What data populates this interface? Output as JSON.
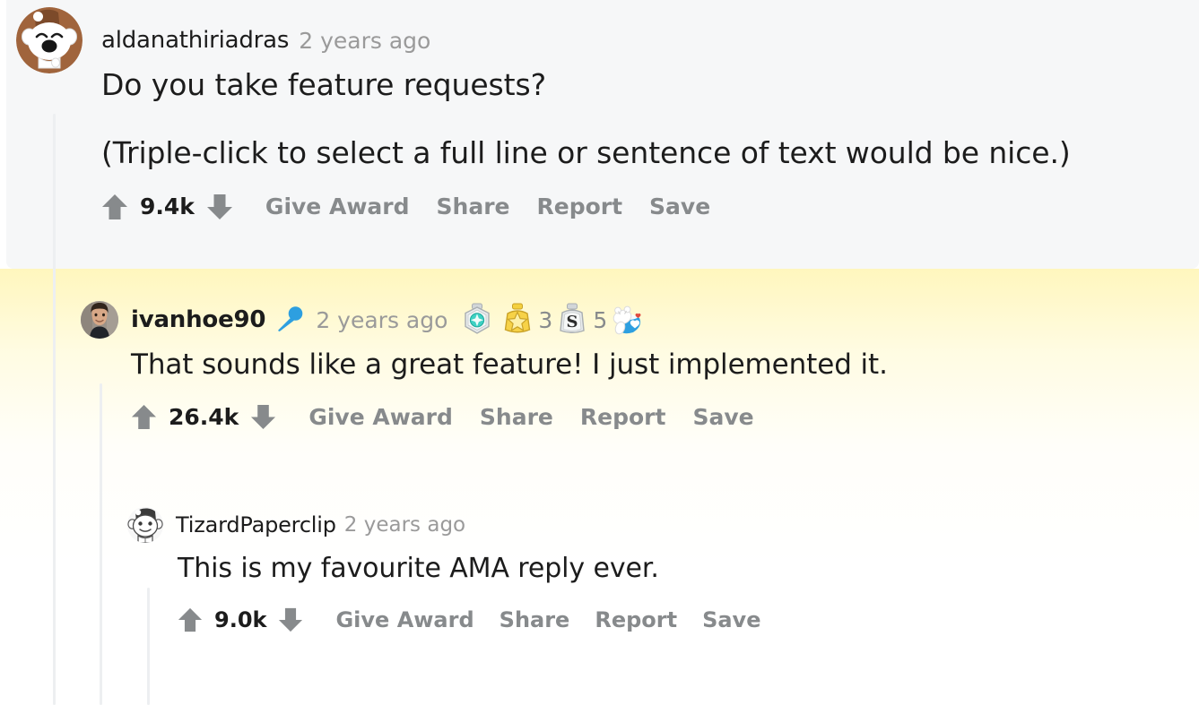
{
  "theme": {
    "highlight_bg": "#f6f7f8",
    "page_bg": "#ffffff",
    "thread_line": "#edeff1",
    "text_primary": "#1c1c1c",
    "text_muted": "#878a8c",
    "timestamp_color": "#9a9a9a",
    "gold_glow": "#fff6ba",
    "mic_badge_color": "#2d9fe0"
  },
  "comments": [
    {
      "id": "comment-1",
      "username": "aldanathiriadras",
      "timestamp": "2 years ago",
      "avatar": "snoo-brown-hair-avatar",
      "body": [
        "Do you take feature requests?",
        "(Triple-click to select a full line or sentence of text would be nice.)"
      ],
      "score": "9.4k",
      "upvote_icon": "upvote-arrow-icon",
      "downvote_icon": "downvote-arrow-icon",
      "actions": [
        "Give Award",
        "Share",
        "Report",
        "Save"
      ],
      "awards": [],
      "highlighted": true
    },
    {
      "id": "comment-2",
      "username": "ivanhoe90",
      "timestamp": "2 years ago",
      "avatar": "photo-portrait-avatar",
      "badge_icon": "microphone-badge-icon",
      "body": [
        "That sounds like a great feature! I just implemented it."
      ],
      "score": "26.4k",
      "upvote_icon": "upvote-arrow-icon",
      "downvote_icon": "downvote-arrow-icon",
      "actions": [
        "Give Award",
        "Share",
        "Report",
        "Save"
      ],
      "awards": [
        {
          "name": "platinum-award",
          "label": "Platinum",
          "count": ""
        },
        {
          "name": "gold-award",
          "label": "Gold",
          "count": "3"
        },
        {
          "name": "silver-award",
          "label": "Silver",
          "count": "5"
        },
        {
          "name": "wholesome-award",
          "label": "Wholesome",
          "count": ""
        }
      ],
      "highlighted": false
    },
    {
      "id": "comment-3",
      "username": "TizardPaperclip",
      "timestamp": "2 years ago",
      "avatar": "snoo-grey-hair-avatar",
      "body": [
        "This is my favourite AMA reply ever."
      ],
      "score": "9.0k",
      "upvote_icon": "upvote-arrow-icon",
      "downvote_icon": "downvote-arrow-icon",
      "actions": [
        "Give Award",
        "Share",
        "Report",
        "Save"
      ],
      "awards": [],
      "highlighted": false
    }
  ]
}
